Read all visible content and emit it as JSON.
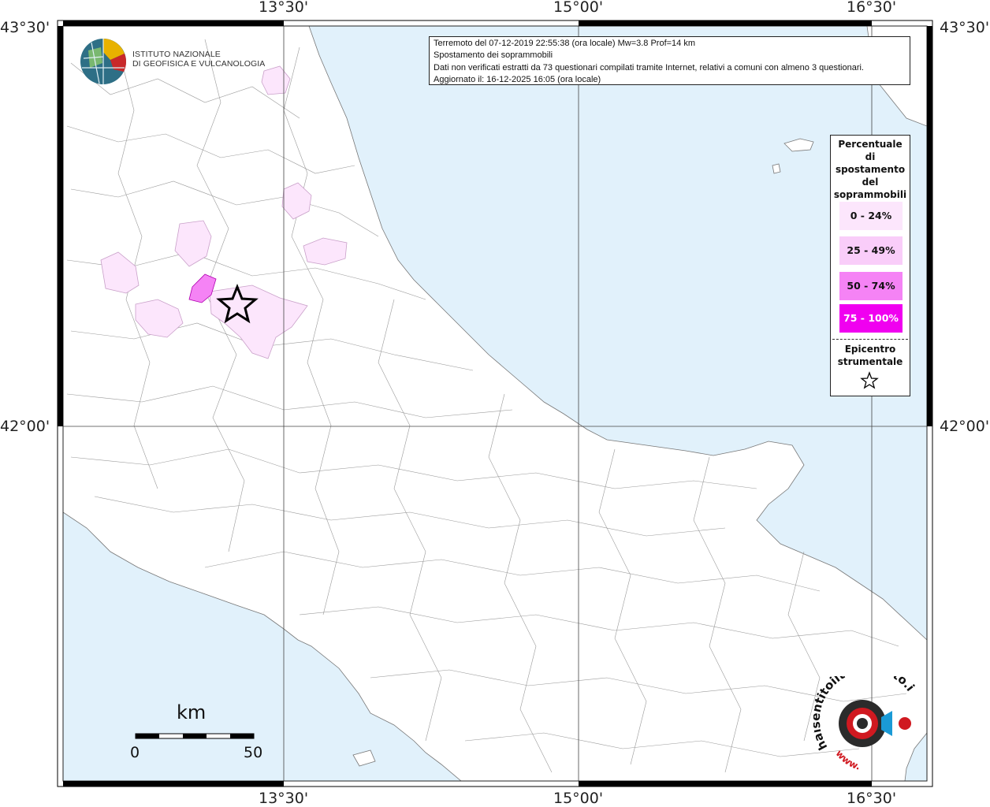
{
  "info": {
    "line1": "Terremoto del 07-12-2019 22:55:38 (ora locale) Mw=3.8 Prof=14 km",
    "line2": "Spostamento dei soprammobili",
    "line3": "Dati non verificati estratti da 73 questionari compilati tramite Internet, relativi a comuni con almeno 3 questionari.",
    "line4": "Aggiornato il: 16-12-2025 16:05 (ora locale)"
  },
  "ingv": {
    "line1": "ISTITUTO NAZIONALE",
    "line2": "DI GEOFISICA E VULCANOLOGIA"
  },
  "axes": {
    "lon_labels": [
      "13°30'",
      "15°00'",
      "16°30'"
    ],
    "lat_labels": [
      "43°30'",
      "42°00'"
    ]
  },
  "legend": {
    "title_lines": [
      "Percentuale",
      "di",
      "spostamento",
      "del",
      "soprammobili"
    ],
    "items": [
      {
        "label": "0 - 24%",
        "color": "#fce6fc"
      },
      {
        "label": "25 - 49%",
        "color": "#f9cdf9"
      },
      {
        "label": "50 - 74%",
        "color": "#f583f5"
      },
      {
        "label": "75 - 100%",
        "color": "#f000f0"
      }
    ],
    "epicenter_lines": [
      "Epicentro",
      "strumentale"
    ],
    "star_icon": "star-icon"
  },
  "scale": {
    "unit": "km",
    "start": "0",
    "end": "50"
  },
  "hst": {
    "text": "haisentitoilterremoto.it",
    "url": "www."
  },
  "colors": {
    "sea": "#e1f1fb",
    "land": "#ffffff",
    "boundary": "#8c8c8c"
  }
}
